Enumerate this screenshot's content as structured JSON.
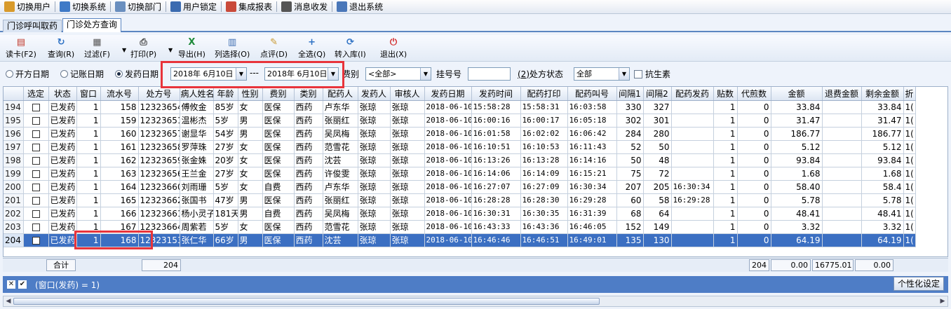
{
  "menu": [
    {
      "label": "切换用户",
      "icon": "users-icon",
      "color": "#d89a2b"
    },
    {
      "label": "切换系统",
      "icon": "switch-system-icon",
      "color": "#3f7ac7"
    },
    {
      "label": "切换部门",
      "icon": "department-icon",
      "color": "#6a8fbf"
    },
    {
      "label": "用户锁定",
      "icon": "user-lock-icon",
      "color": "#3b6bb0"
    },
    {
      "label": "集成报表",
      "icon": "report-icon",
      "color": "#c94a3a"
    },
    {
      "label": "消息收发",
      "icon": "info-icon",
      "color": "#555555"
    },
    {
      "label": "退出系统",
      "icon": "exit-icon",
      "color": "#4a77b9"
    }
  ],
  "tabs": [
    "门诊呼叫取药",
    "门诊处方查询"
  ],
  "active_tab": 1,
  "toolbar": [
    {
      "label": "读卡(F2)",
      "icon": "card-reader-icon",
      "glyph": "▤",
      "color": "#c0392b"
    },
    {
      "label": "查询(R)",
      "icon": "refresh-icon",
      "glyph": "↻",
      "color": "#2f72c4"
    },
    {
      "label": "过滤(F)",
      "icon": "filter-icon",
      "glyph": "▦",
      "color": "#555555"
    },
    {
      "label": "打印(P)",
      "icon": "printer-icon",
      "glyph": "⎙",
      "color": "#444444"
    },
    {
      "label": "导出(H)",
      "icon": "excel-icon",
      "glyph": "X",
      "color": "#1f8a3b"
    },
    {
      "label": "列选择(O)",
      "icon": "column-select-icon",
      "glyph": "▥",
      "color": "#3b6bb0"
    },
    {
      "label": "点评(D)",
      "icon": "comment-icon",
      "glyph": "✎",
      "color": "#c8962a"
    },
    {
      "label": "全选(Q)",
      "icon": "plus-icon",
      "glyph": "+",
      "color": "#2f72c4"
    },
    {
      "label": "转入库(I)",
      "icon": "transfer-icon",
      "glyph": "⟳",
      "color": "#2f72c4"
    },
    {
      "label": "退出(X)",
      "icon": "power-icon",
      "glyph": "⏻",
      "color": "#d32f2f"
    }
  ],
  "filter": {
    "radio_open_date": "开方日期",
    "radio_account_date": "记账日期",
    "radio_dispense_date": "发药日期",
    "date_from": "2018年 6月10日",
    "date_sep": "---",
    "date_to": "2018年 6月10日",
    "fee_label": "费别",
    "fee_value": "<全部>",
    "reg_no_label": "挂号号",
    "reg_no_value": "",
    "status_label_num": "(2)",
    "status_label": "处方状态",
    "status_value": "全部",
    "antibiotic_label": "抗生素"
  },
  "columns": [
    "",
    "选定",
    "状态",
    "窗口",
    "流水号",
    "处方号",
    "病人姓名",
    "年龄",
    "性别",
    "费别",
    "类别",
    "配药人",
    "发药人",
    "审核人",
    "发药日期",
    "发药时间",
    "配药打印",
    "配药叫号",
    "间隔1",
    "间隔2",
    "配药发药",
    "贴数",
    "代煎数",
    "金额",
    "退费金额",
    "剩余金额",
    "折"
  ],
  "rows": [
    [
      "194",
      "",
      "已发药",
      "1",
      "158",
      "12323654",
      "傅攸金",
      "85岁",
      "女",
      "医保",
      "西药",
      "卢东华",
      "张琼",
      "张琼",
      "2018-06-10",
      "15:58:28",
      "15:58:31",
      "16:03:58",
      "330",
      "327",
      "",
      "1",
      "0",
      "33.84",
      "",
      "33.84",
      "1("
    ],
    [
      "195",
      "",
      "已发药",
      "1",
      "159",
      "12323651",
      "温彬杰",
      "5岁",
      "男",
      "医保",
      "西药",
      "张丽红",
      "张琼",
      "张琼",
      "2018-06-10",
      "16:00:16",
      "16:00:17",
      "16:05:18",
      "302",
      "301",
      "",
      "1",
      "0",
      "31.47",
      "",
      "31.47",
      "1("
    ],
    [
      "196",
      "",
      "已发药",
      "1",
      "160",
      "12323657",
      "谢显华",
      "54岁",
      "男",
      "医保",
      "西药",
      "吴凤梅",
      "张琼",
      "张琼",
      "2018-06-10",
      "16:01:58",
      "16:02:02",
      "16:06:42",
      "284",
      "280",
      "",
      "1",
      "0",
      "186.77",
      "",
      "186.77",
      "1("
    ],
    [
      "197",
      "",
      "已发药",
      "1",
      "161",
      "12323658",
      "罗萍珠",
      "27岁",
      "女",
      "医保",
      "西药",
      "范雪花",
      "张琼",
      "张琼",
      "2018-06-10",
      "16:10:51",
      "16:10:53",
      "16:11:43",
      "52",
      "50",
      "",
      "1",
      "0",
      "5.12",
      "",
      "5.12",
      "1("
    ],
    [
      "198",
      "",
      "已发药",
      "1",
      "162",
      "12323659",
      "张金姝",
      "20岁",
      "女",
      "医保",
      "西药",
      "沈芸",
      "张琼",
      "张琼",
      "2018-06-10",
      "16:13:26",
      "16:13:28",
      "16:14:16",
      "50",
      "48",
      "",
      "1",
      "0",
      "93.84",
      "",
      "93.84",
      "1("
    ],
    [
      "199",
      "",
      "已发药",
      "1",
      "163",
      "12323656",
      "王兰金",
      "27岁",
      "女",
      "医保",
      "西药",
      "许俊雯",
      "张琼",
      "张琼",
      "2018-06-10",
      "16:14:06",
      "16:14:09",
      "16:15:21",
      "75",
      "72",
      "",
      "1",
      "0",
      "1.68",
      "",
      "1.68",
      "1("
    ],
    [
      "200",
      "",
      "已发药",
      "1",
      "164",
      "12323660",
      "刘雨珊",
      "5岁",
      "女",
      "自费",
      "西药",
      "卢东华",
      "张琼",
      "张琼",
      "2018-06-10",
      "16:27:07",
      "16:27:09",
      "16:30:34",
      "207",
      "205",
      "16:30:34",
      "1",
      "0",
      "58.40",
      "",
      "58.4",
      "1("
    ],
    [
      "201",
      "",
      "已发药",
      "1",
      "165",
      "12323662",
      "张国书",
      "47岁",
      "男",
      "医保",
      "西药",
      "张丽红",
      "张琼",
      "张琼",
      "2018-06-10",
      "16:28:28",
      "16:28:30",
      "16:29:28",
      "60",
      "58",
      "16:29:28",
      "1",
      "0",
      "5.78",
      "",
      "5.78",
      "1("
    ],
    [
      "202",
      "",
      "已发药",
      "1",
      "166",
      "12323661",
      "杨小灵子",
      "181天",
      "男",
      "自费",
      "西药",
      "吴凤梅",
      "张琼",
      "张琼",
      "2018-06-10",
      "16:30:31",
      "16:30:35",
      "16:31:39",
      "68",
      "64",
      "",
      "1",
      "0",
      "48.41",
      "",
      "48.41",
      "1("
    ],
    [
      "203",
      "",
      "已发药",
      "1",
      "167",
      "12323664",
      "周紫若",
      "5岁",
      "女",
      "医保",
      "西药",
      "范雪花",
      "张琼",
      "张琼",
      "2018-06-10",
      "16:43:33",
      "16:43:36",
      "16:46:05",
      "152",
      "149",
      "",
      "1",
      "0",
      "3.32",
      "",
      "3.32",
      "1("
    ],
    [
      "204",
      "",
      "已发药",
      "1",
      "168",
      "12323153",
      "张仁华",
      "66岁",
      "男",
      "医保",
      "西药",
      "沈芸",
      "张琼",
      "张琼",
      "2018-06-10",
      "16:46:46",
      "16:46:51",
      "16:49:01",
      "135",
      "130",
      "",
      "1",
      "0",
      "64.19",
      "",
      "64.19",
      "1("
    ]
  ],
  "selected_row": 10,
  "summary": {
    "label": "合计",
    "count": "204",
    "tie_count": "204",
    "decoct": "0.00",
    "amount": "16775.01",
    "refund": "0.00"
  },
  "footer": {
    "filter_text": "(窗口(发药) = 1)",
    "custom_button": "个性化设定"
  }
}
